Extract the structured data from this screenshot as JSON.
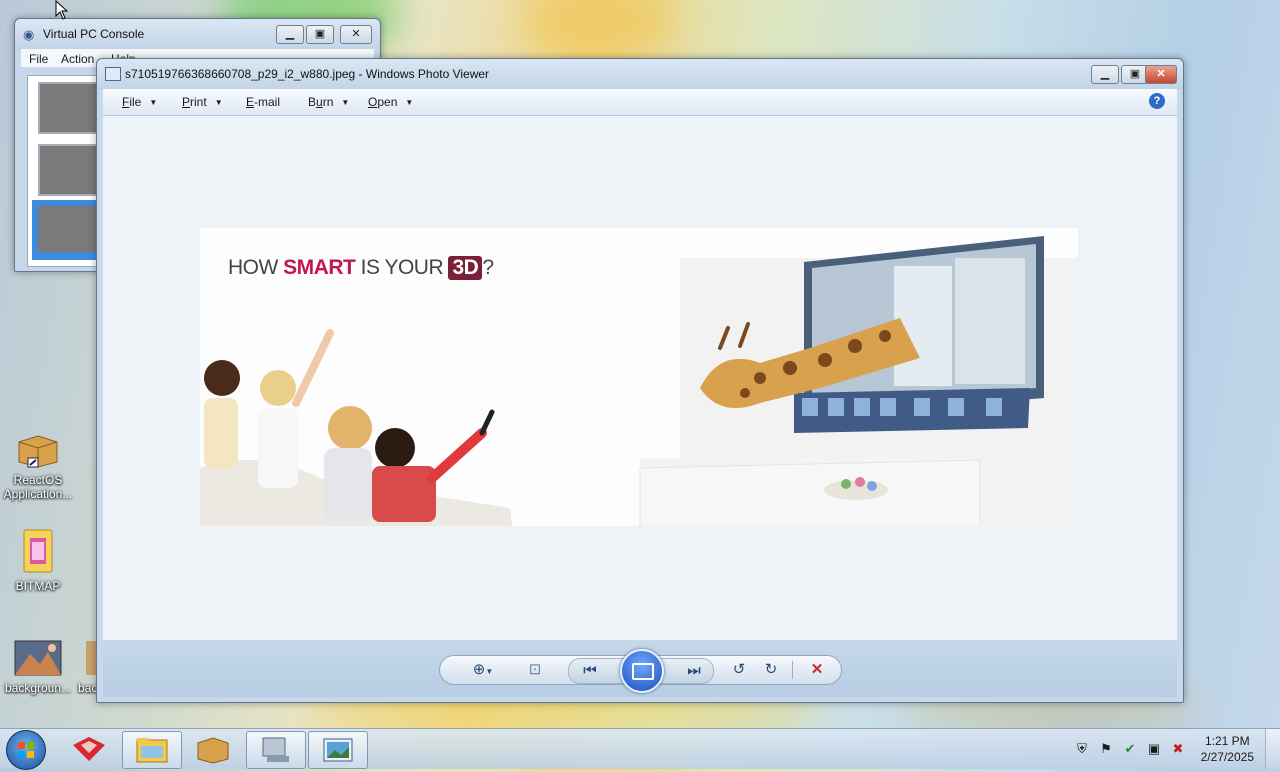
{
  "desktop": {
    "icons": [
      {
        "label": "ReactOS Application...",
        "icon": "package-icon"
      },
      {
        "label": "BITMAP",
        "icon": "folder-icon"
      },
      {
        "label": "backgroun...",
        "icon": "image-file-icon"
      },
      {
        "label": "bac",
        "icon": "image-file-icon"
      }
    ]
  },
  "vpc_window": {
    "title": "Virtual PC Console",
    "menu": [
      "File",
      "Action",
      "Help"
    ]
  },
  "photo_viewer": {
    "title": "s710519766368660708_p29_i2_w880.jpeg - Windows Photo Viewer",
    "menu": [
      {
        "label": "File",
        "access": "F"
      },
      {
        "label": "Print",
        "access": "P"
      },
      {
        "label": "E-mail",
        "access": "E"
      },
      {
        "label": "Burn",
        "access": "u"
      },
      {
        "label": "Open",
        "access": "O"
      }
    ],
    "image": {
      "headline_pre": "HOW ",
      "headline_accent": "SMART",
      "headline_mid": " IS YOUR ",
      "headline_3d": "3D",
      "headline_end": "?"
    }
  },
  "colors": {
    "accent": "#c0184f",
    "window_chrome": "#c7d8ea",
    "close_red": "#c7452b"
  },
  "taskbar": {
    "clock_time": "1:21 PM",
    "clock_date": "2/27/2025"
  }
}
